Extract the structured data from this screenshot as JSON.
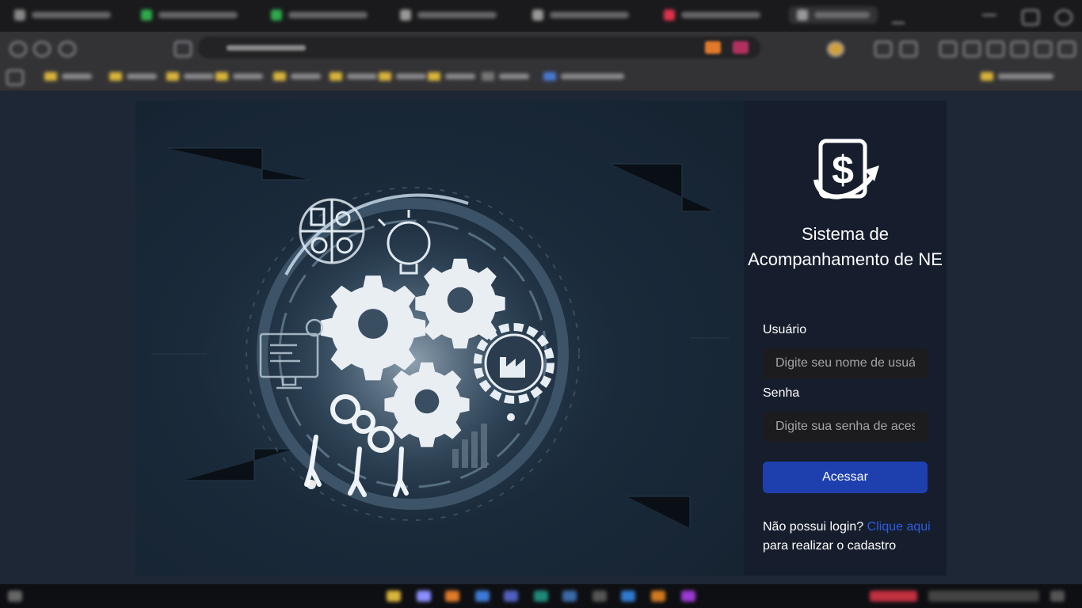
{
  "login": {
    "title": "Sistema de Acompanhamento de NE",
    "username_label": "Usuário",
    "username_placeholder": "Digite seu nome de usuário",
    "password_label": "Senha",
    "password_placeholder": "Digite sua senha de acesso",
    "submit_label": "Acessar",
    "signup_prefix": "Não possui login?",
    "signup_link": "Clique aqui",
    "signup_suffix": "para realizar o cadastro"
  },
  "colors": {
    "page_bg": "#1e2736",
    "panel_bg": "#161e2d",
    "button": "#1e40af",
    "link": "#2e5be0"
  },
  "icons": {
    "logo": "dollar-document-arrow-icon",
    "hero": "gears-and-teamwork-illustration"
  }
}
